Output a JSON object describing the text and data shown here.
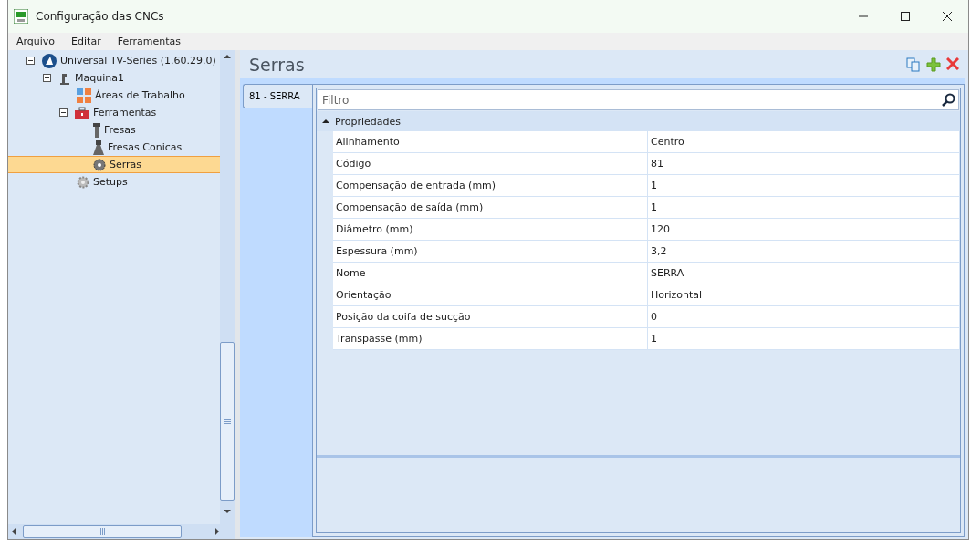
{
  "window": {
    "title": "Configuração das CNCs"
  },
  "menu": [
    "Arquivo",
    "Editar",
    "Ferramentas"
  ],
  "tree": [
    {
      "label": "Universal TV-Series (1.60.29.0)",
      "expanded": true,
      "selected": false,
      "children": [
        {
          "label": "Maquina1",
          "expanded": true,
          "selected": false,
          "children": [
            {
              "label": "Áreas de Trabalho",
              "selected": false
            },
            {
              "label": "Ferramentas",
              "expanded": true,
              "selected": false,
              "children": [
                {
                  "label": "Fresas",
                  "selected": false
                },
                {
                  "label": "Fresas Conicas",
                  "selected": false
                },
                {
                  "label": "Serras",
                  "selected": true
                }
              ]
            },
            {
              "label": "Setups",
              "selected": false
            }
          ]
        }
      ]
    }
  ],
  "panel": {
    "title": "Serras",
    "tabs": [
      {
        "label": "81 - SERRA",
        "selected": true
      }
    ],
    "filter": {
      "placeholder": "Filtro"
    },
    "category": {
      "label": "Propriedades",
      "expanded": true
    },
    "properties": [
      {
        "name": "Alinhamento",
        "value": "Centro"
      },
      {
        "name": "Código",
        "value": "81"
      },
      {
        "name": "Compensação de entrada (mm)",
        "value": "1"
      },
      {
        "name": "Compensação de saída (mm)",
        "value": "1"
      },
      {
        "name": "Diâmetro (mm)",
        "value": "120"
      },
      {
        "name": "Espessura (mm)",
        "value": "3,2"
      },
      {
        "name": "Nome",
        "value": "SERRA"
      },
      {
        "name": "Orientação",
        "value": "Horizontal"
      },
      {
        "name": "Posição da coifa de sucção",
        "value": "0"
      },
      {
        "name": "Transpasse (mm)",
        "value": "1"
      }
    ]
  }
}
